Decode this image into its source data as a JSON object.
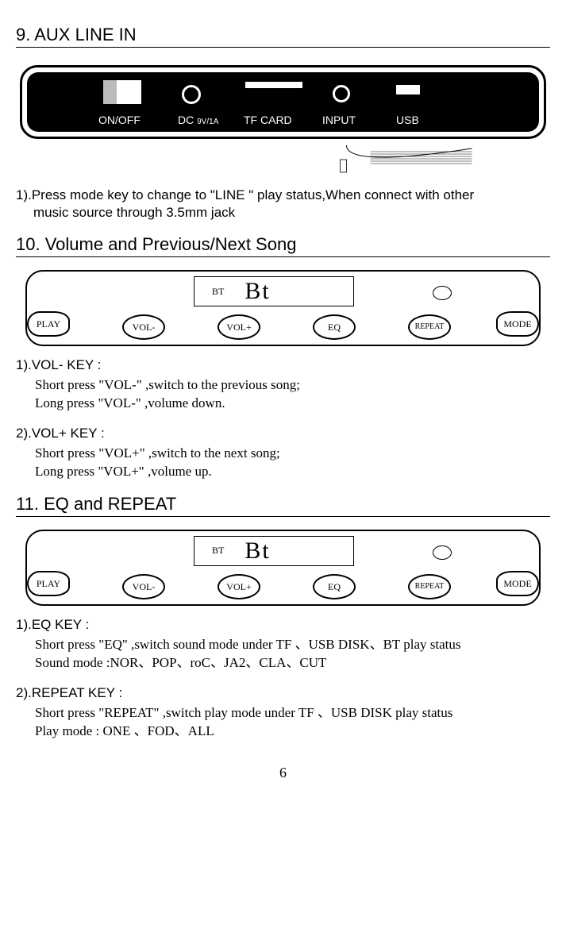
{
  "sec9": {
    "title": "9. AUX LINE IN",
    "back_panel": {
      "onoff": "ON/OFF",
      "dc": "DC",
      "dc_sub": "9V/1A",
      "tf": "TF CARD",
      "input": "INPUT",
      "usb": "USB"
    },
    "instr": "1).Press mode key to change to \"LINE \" play status,When connect with other",
    "instr2": "music source through 3.5mm jack"
  },
  "sec10": {
    "title": "10.  Volume and Previous/Next Song",
    "display_small": "BT",
    "display_large": "Bt",
    "buttons": {
      "play": "PLAY",
      "vol_minus": "VOL-",
      "vol_plus": "VOL+",
      "eq": "EQ",
      "repeat": "REPEAT",
      "mode": "MODE"
    },
    "vol_minus_head": "1).VOL-  KEY :",
    "vol_minus_l1": "Short press  \"VOL-\" ,switch to the previous  song;",
    "vol_minus_l2": "Long press  \"VOL-\" ,volume down.",
    "vol_plus_head": "2).VOL+  KEY :",
    "vol_plus_l1": "Short press  \"VOL+\" ,switch to the next  song;",
    "vol_plus_l2": "Long press  \"VOL+\" ,volume up."
  },
  "sec11": {
    "title": "11.  EQ and REPEAT",
    "display_small": "BT",
    "display_large": "Bt",
    "buttons": {
      "play": "PLAY",
      "vol_minus": "VOL-",
      "vol_plus": "VOL+",
      "eq": "EQ",
      "repeat": "REPEAT",
      "mode": "MODE"
    },
    "eq_head": "1).EQ  KEY :",
    "eq_l1": "Short press  \"EQ\" ,switch sound mode under TF 、USB DISK、BT  play status",
    "eq_l2": "Sound mode :NOR、POP、roC、JA2、CLA、CUT",
    "repeat_head": "2).REPEAT  KEY :",
    "repeat_l1": "Short press  \"REPEAT\" ,switch play mode under TF 、USB DISK play status",
    "repeat_l2": "Play mode : ONE 、FOD、ALL"
  },
  "page": "6"
}
